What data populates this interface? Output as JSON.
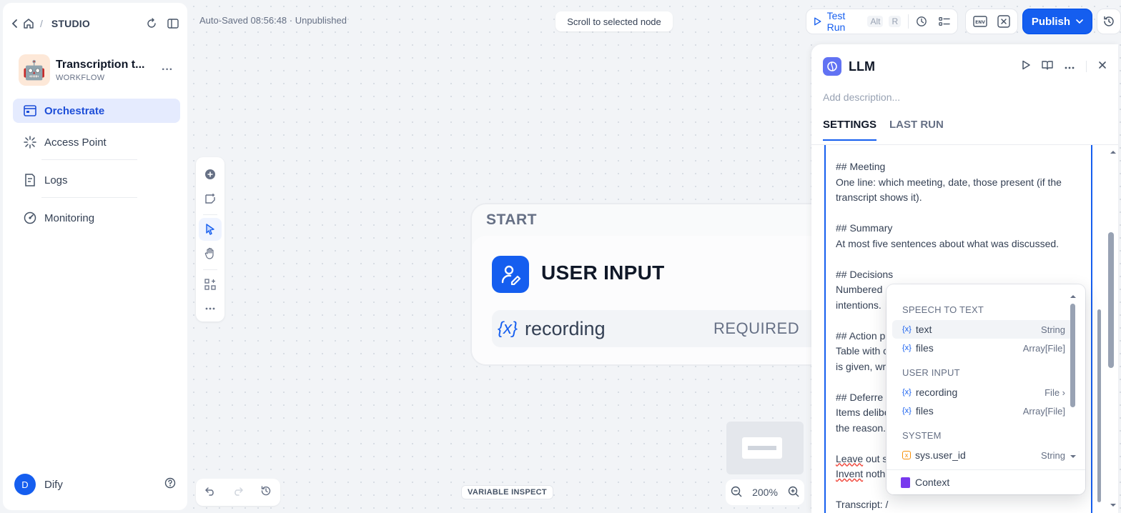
{
  "sidebar": {
    "breadcrumb_label": "STUDIO",
    "app": {
      "name": "Transcription t...",
      "type": "WORKFLOW",
      "emoji": "🤖"
    },
    "nav": [
      {
        "label": "Orchestrate",
        "icon": "orchestrate-icon",
        "active": true
      },
      {
        "label": "Access Point",
        "icon": "access-point-icon"
      },
      {
        "label": "Logs",
        "icon": "logs-icon"
      },
      {
        "label": "Monitoring",
        "icon": "monitoring-icon"
      }
    ],
    "user": {
      "initial": "D",
      "name": "Dify"
    }
  },
  "header": {
    "autosave": "Auto-Saved 08:56:48 · Unpublished",
    "scroll_button": "Scroll to selected node",
    "test_run": {
      "label": "Test Run",
      "kbd1": "Alt",
      "kbd2": "R"
    },
    "publish": "Publish"
  },
  "canvas": {
    "variable_inspect": "VARIABLE INSPECT",
    "zoom": "200%",
    "start_node": {
      "title": "START",
      "name": "USER INPUT",
      "variable": {
        "symbol": "{x}",
        "name": "recording",
        "badge": "REQUIRED"
      }
    }
  },
  "panel": {
    "title": "LLM",
    "description_placeholder": "Add description...",
    "tabs": [
      "SETTINGS",
      "LAST RUN"
    ],
    "prompt": {
      "l1": "## Meeting",
      "l2": "One line: which meeting, date, those present (if the transcript shows it).",
      "l3": "## Summary",
      "l4": "At most five sentences about what was discussed.",
      "l5": "## Decisions",
      "l6": "Numbered",
      "l7": "intentions.",
      "l8": "## Action p",
      "l9": "Table with c",
      "l10": "is given, wr",
      "l11": "## Deferre",
      "l12": "Items delibe",
      "l13": "the reason.",
      "l14a": "Leave",
      "l14b": " out s",
      "l15a": "Invent",
      "l15b": " noth",
      "l16": "Transcript: /"
    }
  },
  "dropdown": {
    "groups": [
      {
        "name": "SPEECH TO TEXT",
        "items": [
          {
            "name": "text",
            "type": "String"
          },
          {
            "name": "files",
            "type": "Array[File]"
          }
        ]
      },
      {
        "name": "USER INPUT",
        "items": [
          {
            "name": "recording",
            "type": "File ›"
          },
          {
            "name": "files",
            "type": "Array[File]"
          }
        ]
      },
      {
        "name": "SYSTEM",
        "items": [
          {
            "name": "sys.user_id",
            "type": "String"
          }
        ]
      }
    ],
    "context_label": "Context"
  }
}
